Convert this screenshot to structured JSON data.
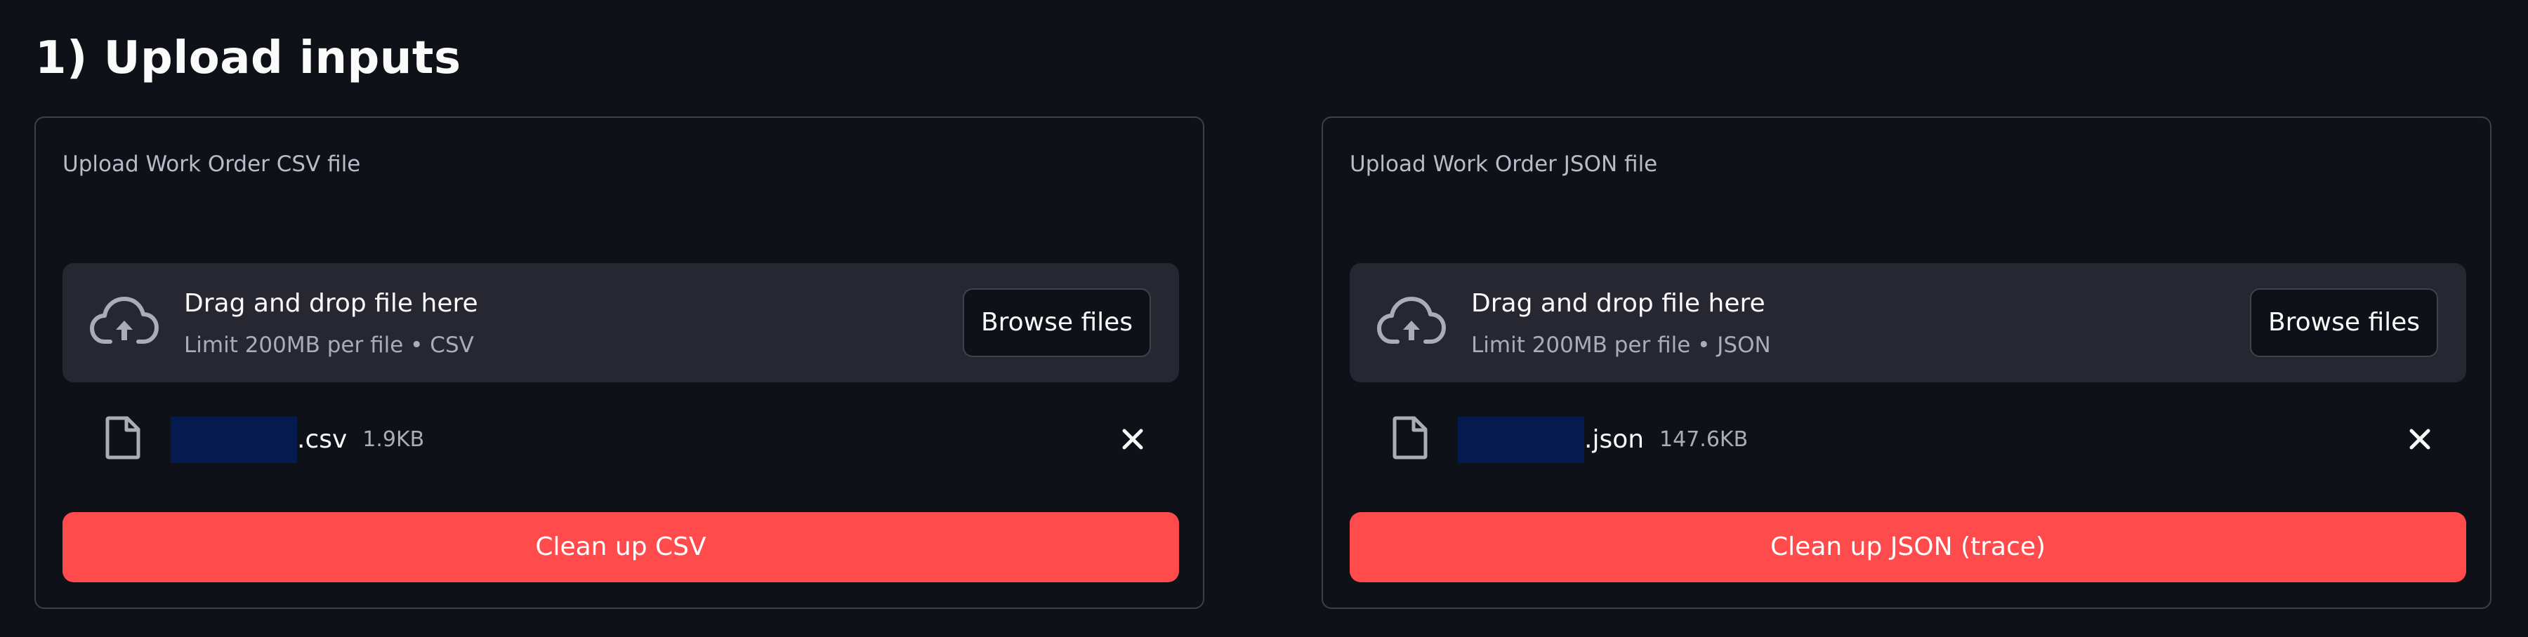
{
  "section": {
    "title": "1) Upload inputs"
  },
  "theme": {
    "background": "#0e1117",
    "panel_border": "#3d4048",
    "dropzone_bg": "#262730",
    "primary_button": "#ff4b4b",
    "redaction": "#051b4f"
  },
  "panels": [
    {
      "label": "Upload Work Order CSV file",
      "dropzone": {
        "icon": "cloud-upload-icon",
        "title": "Drag and drop file here",
        "subtitle": "Limit 200MB per file • CSV",
        "browse_label": "Browse files"
      },
      "file": {
        "icon": "file-icon",
        "extension": ".csv",
        "size": "1.9KB",
        "remove_icon": "close-icon"
      },
      "action_label": "Clean up CSV"
    },
    {
      "label": "Upload Work Order JSON file",
      "dropzone": {
        "icon": "cloud-upload-icon",
        "title": "Drag and drop file here",
        "subtitle": "Limit 200MB per file • JSON",
        "browse_label": "Browse files"
      },
      "file": {
        "icon": "file-icon",
        "extension": ".json",
        "size": "147.6KB",
        "remove_icon": "close-icon"
      },
      "action_label": "Clean up JSON (trace)"
    }
  ]
}
